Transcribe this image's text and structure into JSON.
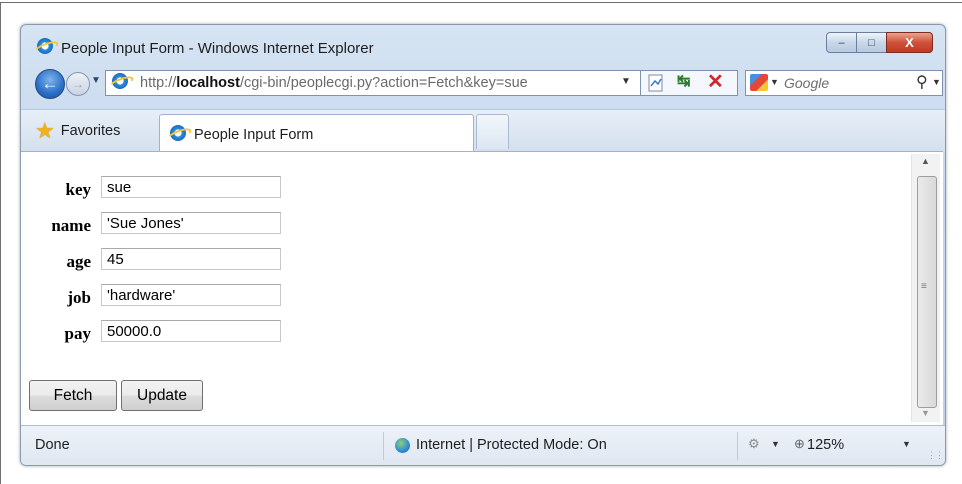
{
  "window": {
    "title": "People Input Form - Windows Internet Explorer",
    "caption_buttons": {
      "minimize": "–",
      "maximize": "□",
      "close": "X"
    }
  },
  "address_bar": {
    "url_prefix": "http://",
    "url_host": "localhost",
    "url_path": "/cgi-bin/peoplecgi.py?action=Fetch&key=sue"
  },
  "search": {
    "placeholder": "Google"
  },
  "favorites_bar": {
    "favorites_label": "Favorites"
  },
  "tabs": [
    {
      "label": "People Input Form",
      "active": true
    }
  ],
  "form": {
    "fields": [
      {
        "label": "key",
        "value": "sue"
      },
      {
        "label": "name",
        "value": "'Sue Jones'"
      },
      {
        "label": "age",
        "value": "45"
      },
      {
        "label": "job",
        "value": "'hardware'"
      },
      {
        "label": "pay",
        "value": "50000.0"
      }
    ],
    "buttons": {
      "fetch": "Fetch",
      "update": "Update"
    }
  },
  "status_bar": {
    "status": "Done",
    "zone": "Internet | Protected Mode: On",
    "zoom": "125%"
  },
  "icons": {
    "back": "back-arrow-icon",
    "forward": "forward-arrow-icon",
    "refresh": "refresh-icon",
    "stop": "stop-icon",
    "favorites": "star-icon",
    "search": "search-icon",
    "zone": "globe-icon"
  },
  "colors": {
    "chrome": "#c3d6ec",
    "close_button": "#c23a22",
    "favorites_star": "#f0b21a"
  }
}
